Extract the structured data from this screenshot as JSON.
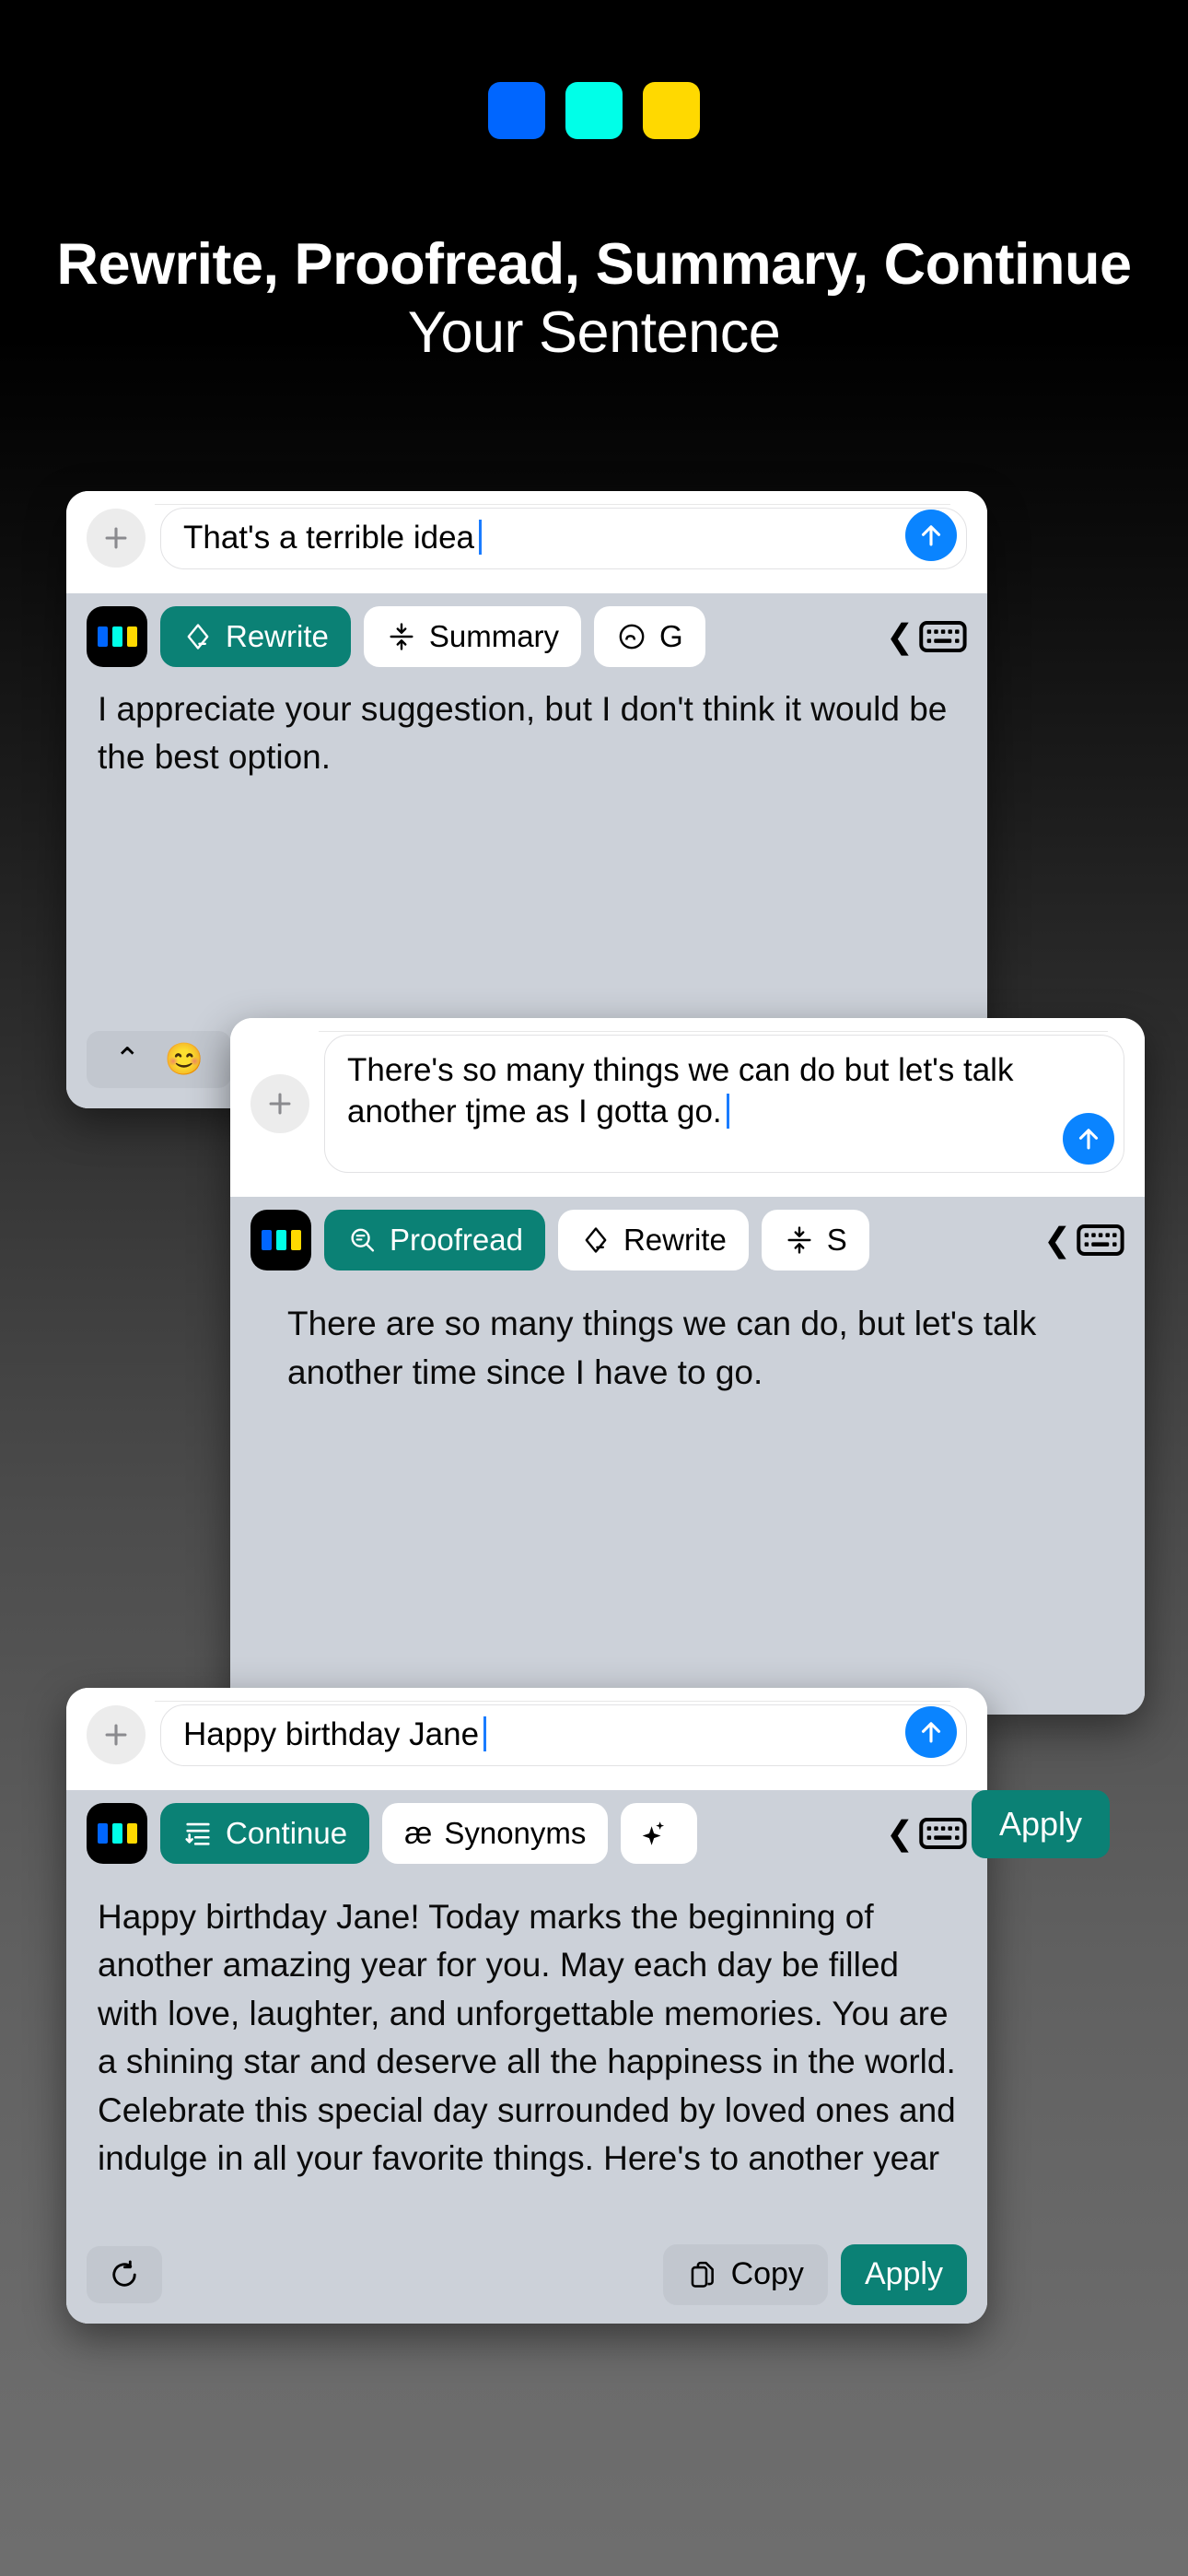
{
  "brand": {
    "logo_colors": [
      "#0066ff",
      "#00ffe8",
      "#ffd900"
    ]
  },
  "headline": {
    "bold_part": "Rewrite, Proofread, Summary, Continue",
    "regular_part": " Your Sentence"
  },
  "cards": [
    {
      "id": "card-rewrite",
      "input_text": "That's a terrible idea",
      "plus_label": "+",
      "send_label": "send",
      "toolbar": [
        {
          "label": "Rewrite",
          "icon": "rewrite-icon",
          "active": true
        },
        {
          "label": "Summary",
          "icon": "summary-icon",
          "active": false
        },
        {
          "label": "G",
          "icon": "grammar-icon",
          "active": false
        }
      ],
      "result_text": "I appreciate your suggestion, but I don't think it would be the best option.",
      "emoji_bar": {
        "chevron": "⌃",
        "emoji": "😊"
      }
    },
    {
      "id": "card-proofread",
      "input_text": "There's so many things we can do but let's talk another tjme as I gotta go.",
      "plus_label": "+",
      "send_label": "send",
      "toolbar": [
        {
          "label": "Proofread",
          "icon": "proofread-icon",
          "active": true
        },
        {
          "label": "Rewrite",
          "icon": "rewrite-icon",
          "active": false
        },
        {
          "label": "S",
          "icon": "summary-icon",
          "active": false
        }
      ],
      "result_text": "There are so many things we can do, but let's talk another time since I have to go.",
      "apply_label": "Apply"
    },
    {
      "id": "card-continue",
      "input_text": "Happy birthday Jane",
      "plus_label": "+",
      "send_label": "send",
      "toolbar": [
        {
          "label": "Continue",
          "icon": "continue-icon",
          "active": true
        },
        {
          "label": "Synonyms",
          "icon": "synonyms-icon",
          "active": false
        },
        {
          "label": "",
          "icon": "sparkle-icon",
          "active": false
        }
      ],
      "result_text": "Happy birthday Jane! Today marks the beginning of another amazing year for you. May each day be filled with love, laughter, and unforgettable memories. You are a shining star and deserve all the happiness in the world. Celebrate this special day surrounded by loved ones and indulge in all your favorite things. Here's to another year",
      "actions": {
        "refresh": "refresh-icon",
        "copy_label": "Copy",
        "apply_label": "Apply"
      }
    }
  ],
  "colors": {
    "accent_teal": "#0b8175",
    "send_blue": "#0a84ff",
    "keyboard_bg": "#ccd1d9"
  }
}
